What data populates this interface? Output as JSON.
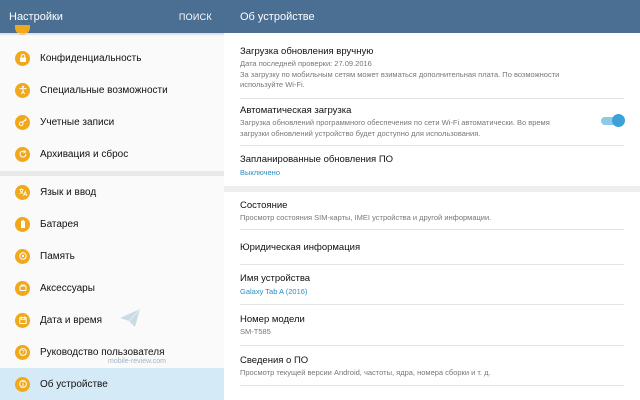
{
  "left_header": {
    "title": "Настройки",
    "search": "ПОИСК"
  },
  "menu": [
    {
      "label": "Конфиденциальность",
      "icon": "lock-icon"
    },
    {
      "label": "Специальные возможности",
      "icon": "accessibility-icon"
    },
    {
      "label": "Учетные записи",
      "icon": "key-icon"
    },
    {
      "label": "Архивация и сброс",
      "icon": "backup-icon"
    },
    {
      "label": "Язык и ввод",
      "icon": "language-icon"
    },
    {
      "label": "Батарея",
      "icon": "battery-icon"
    },
    {
      "label": "Память",
      "icon": "memory-icon"
    },
    {
      "label": "Аксессуары",
      "icon": "accessories-icon"
    },
    {
      "label": "Дата и время",
      "icon": "calendar-icon"
    },
    {
      "label": "Руководство пользователя",
      "icon": "manual-icon"
    },
    {
      "label": "Об устройстве",
      "icon": "info-icon",
      "selected": true
    }
  ],
  "watermark": "mobile-review.com",
  "right_header": {
    "title": "Об устройстве"
  },
  "rows": {
    "manual_update": {
      "title": "Загрузка обновления вручную",
      "line1": "Дата последней проверки: 27.09.2016",
      "line2": "За загрузку по мобильным сетям может взиматься дополнительная плата. По возможности",
      "line3": "используйте Wi-Fi."
    },
    "auto_download": {
      "title": "Автоматическая загрузка",
      "line1": "Загрузка обновлений программного обеспечения по сети Wi-Fi автоматически. Во время",
      "line2": "загрузки обновлений устройство будет доступно для использования.",
      "toggle_on": true
    },
    "scheduled": {
      "title": "Запланированные обновления ПО",
      "value": "Выключено"
    },
    "status": {
      "title": "Состояние",
      "sub": "Просмотр состояния SIM-карты, IMEI устройства и другой информации."
    },
    "legal": {
      "title": "Юридическая информация"
    },
    "device_name": {
      "title": "Имя устройства",
      "value": "Galaxy Tab A (2016)"
    },
    "model": {
      "title": "Номер модели",
      "value": "SM-T585"
    },
    "software": {
      "title": "Сведения о ПО",
      "sub": "Просмотр текущей версии Android, частоты, ядра, номера сборки и т. д."
    }
  },
  "colors": {
    "header": "#4a6f92",
    "accent": "#2b8ec8",
    "icon": "#f0a81c",
    "selected": "#d4eaf6"
  }
}
